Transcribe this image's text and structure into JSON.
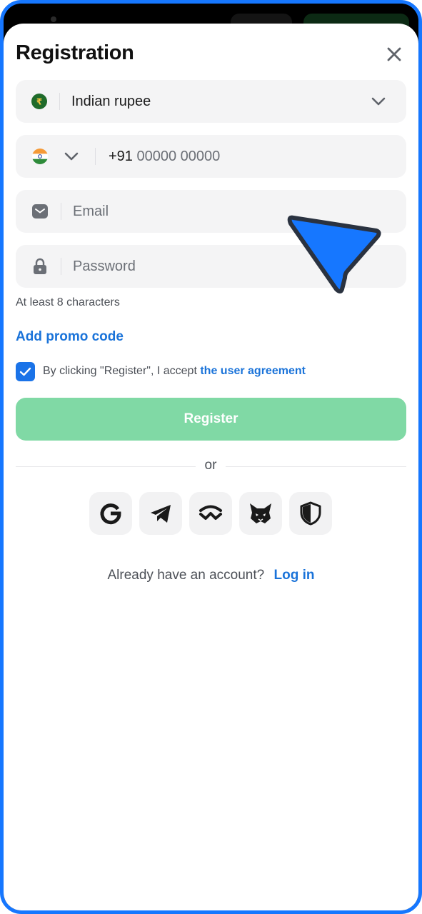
{
  "header": {
    "title": "Registration"
  },
  "currency": {
    "symbol": "₹",
    "label": "Indian rupee"
  },
  "phone": {
    "code": "+91",
    "placeholder": "00000 00000"
  },
  "email": {
    "placeholder": "Email"
  },
  "password": {
    "placeholder": "Password",
    "hint": "At least 8 characters"
  },
  "promo": {
    "label": "Add promo code"
  },
  "agreement": {
    "checked": true,
    "text": "By clicking \"Register\", I accept",
    "link": "the user agreement"
  },
  "register": {
    "label": "Register"
  },
  "divider": {
    "label": "or"
  },
  "social": [
    {
      "icon": "google-icon"
    },
    {
      "icon": "telegram-icon"
    },
    {
      "icon": "walletconnect-icon"
    },
    {
      "icon": "metamask-icon"
    },
    {
      "icon": "shield-icon"
    }
  ],
  "login": {
    "prompt": "Already have an account?",
    "link": "Log in"
  },
  "colors": {
    "accent": "#1a73d9",
    "register_bg": "#80d9a5",
    "frame": "#1677ff",
    "cursor": "#1677ff"
  }
}
